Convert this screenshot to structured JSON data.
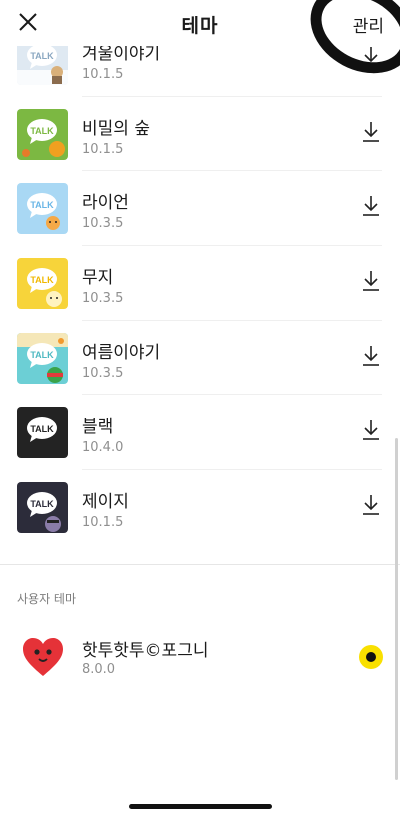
{
  "header": {
    "title": "테마",
    "manage_label": "관리",
    "close_icon": "close-icon"
  },
  "themes": [
    {
      "name": "겨울이야기",
      "version": "10.1.5",
      "thumb": "winter",
      "bubble": "#ffffff",
      "bg": "#dfe9f2"
    },
    {
      "name": "비밀의 숲",
      "version": "10.1.5",
      "thumb": "forest",
      "bubble": "#ffffff",
      "bg": "#7cb842"
    },
    {
      "name": "라이언",
      "version": "10.3.5",
      "thumb": "ryan",
      "bubble": "#ffffff",
      "bg": "#a9d8f4"
    },
    {
      "name": "무지",
      "version": "10.3.5",
      "thumb": "muzi",
      "bubble": "#ffffff",
      "bg": "#f7d43a"
    },
    {
      "name": "여름이야기",
      "version": "10.3.5",
      "thumb": "summer",
      "bubble": "#ffffff",
      "bg": "#6ccfd5"
    },
    {
      "name": "블랙",
      "version": "10.4.0",
      "thumb": "black",
      "bubble": "#ffffff",
      "bg": "#232323"
    },
    {
      "name": "제이지",
      "version": "10.1.5",
      "thumb": "jayg",
      "bubble": "#ffffff",
      "bg": "#2c2c3a"
    }
  ],
  "user_section": {
    "label": "사용자 테마",
    "theme": {
      "name": "핫투핫투©포그니",
      "version": "8.0.0",
      "selected": true
    }
  },
  "colors": {
    "accent_yellow": "#f9e000",
    "version_gray": "#8f8f8f"
  },
  "icons": {
    "download": "download-icon",
    "heart": "heart-icon"
  }
}
